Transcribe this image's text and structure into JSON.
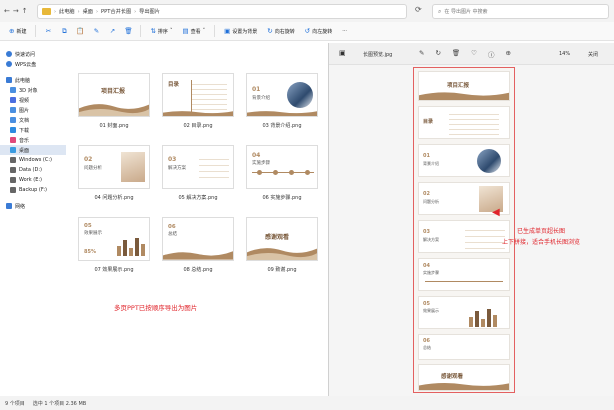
{
  "address": {
    "crumbs": [
      "此电脑",
      "桌面",
      "PPT合并长图",
      "导出图片"
    ],
    "search_placeholder": "在 导出图片 中搜索"
  },
  "toolbar": {
    "new_label": "新建",
    "sort_label": "排序",
    "view_label": "查看",
    "set_bg_label": "设置为背景",
    "rotate_right_label": "向右旋转",
    "rotate_left_label": "向左旋转",
    "more_label": "···"
  },
  "sidebar": {
    "items": [
      {
        "label": "快速访问",
        "icon": "star-icon",
        "color": "#3a7bd5"
      },
      {
        "label": "WPS云盘",
        "icon": "cloud-icon",
        "color": "#3a7bd5"
      },
      {
        "label": "此电脑",
        "icon": "computer-icon",
        "color": "#3a7bd5"
      },
      {
        "label": "3D 对象",
        "icon": "cube-icon",
        "color": "#4a8fe0"
      },
      {
        "label": "视频",
        "icon": "video-icon",
        "color": "#4a6ee0"
      },
      {
        "label": "图片",
        "icon": "image-icon",
        "color": "#4a8fe0"
      },
      {
        "label": "文档",
        "icon": "document-icon",
        "color": "#4a8fe0"
      },
      {
        "label": "下载",
        "icon": "download-icon",
        "color": "#2e8be0"
      },
      {
        "label": "音乐",
        "icon": "music-icon",
        "color": "#e04a7b"
      },
      {
        "label": "桌面",
        "icon": "desktop-icon",
        "color": "#3a9be0"
      },
      {
        "label": "Windows (C:)",
        "icon": "drive-icon",
        "color": "#666666"
      },
      {
        "label": "Data (D:)",
        "icon": "drive-icon",
        "color": "#666666"
      },
      {
        "label": "Work (E:)",
        "icon": "drive-icon",
        "color": "#666666"
      },
      {
        "label": "Backup (F:)",
        "icon": "drive-icon",
        "color": "#666666"
      },
      {
        "label": "网络",
        "icon": "network-icon",
        "color": "#3a7bd5"
      }
    ],
    "selected_index": 9
  },
  "files": [
    {
      "name": "01 封面.png",
      "title": "项目汇报"
    },
    {
      "name": "02 目录.png",
      "title": "目录"
    },
    {
      "name": "03 背景介绍.png",
      "title": "01",
      "sub": "背景介绍"
    },
    {
      "name": "04 问题分析.png",
      "title": "02",
      "sub": "问题分析"
    },
    {
      "name": "05 解决方案.png",
      "title": "03",
      "sub": "解决方案"
    },
    {
      "name": "06 实施步骤.png",
      "title": "04",
      "sub": "实施步骤"
    },
    {
      "name": "07 效果展示.png",
      "title": "05",
      "sub": "效果展示",
      "extra": "85%"
    },
    {
      "name": "08 总结.png",
      "title": "06",
      "sub": "总结"
    },
    {
      "name": "09 致谢.png",
      "title": "感谢观看"
    }
  ],
  "content_note": "多页PPT已按顺序导出为图片",
  "viewer": {
    "title": "长图预览.jpg",
    "zoom": "14%",
    "close_label": "关闭",
    "note_line1": "已生成单页超长图",
    "note_line2": "上下拼接，适合手机长图浏览",
    "long_slides": [
      {
        "title": "项目汇报"
      },
      {
        "title": "目录"
      },
      {
        "title": "01",
        "sub": "背景介绍"
      },
      {
        "title": "02",
        "sub": "问题分析"
      },
      {
        "title": "03",
        "sub": "解决方案"
      },
      {
        "title": "04",
        "sub": "实施步骤"
      },
      {
        "title": "05",
        "sub": "效果展示"
      },
      {
        "title": "06",
        "sub": "总结"
      },
      {
        "title": "感谢观看"
      }
    ]
  },
  "status": {
    "count": "9 个项目",
    "selection": "选中 1 个项目 2.36 MB"
  },
  "colors": {
    "accent": "#1e6fd9",
    "slide_brown": "#7a5a3c",
    "annotation_red": "#e0232a"
  }
}
